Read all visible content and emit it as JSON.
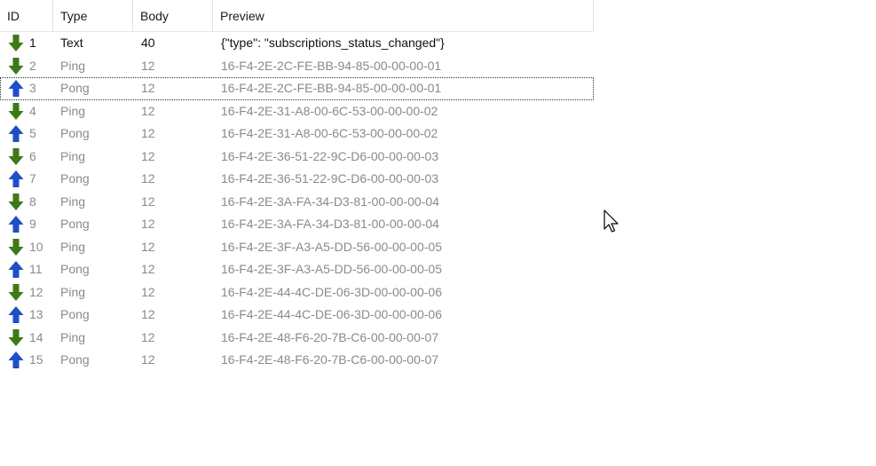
{
  "columns": {
    "id": "ID",
    "type": "Type",
    "body": "Body",
    "preview": "Preview"
  },
  "colors": {
    "incoming_arrow": "#3d7a16",
    "outgoing_arrow": "#1f4fc7"
  },
  "icons": {
    "in": "arrow-down-icon",
    "out": "arrow-up-icon"
  },
  "selected_row": 3,
  "rows": [
    {
      "id": "1",
      "dir": "in",
      "type": "Text",
      "body": "40",
      "preview": "{\"type\": \"subscriptions_status_changed\"}"
    },
    {
      "id": "2",
      "dir": "in",
      "type": "Ping",
      "body": "12",
      "preview": "16-F4-2E-2C-FE-BB-94-85-00-00-00-01"
    },
    {
      "id": "3",
      "dir": "out",
      "type": "Pong",
      "body": "12",
      "preview": "16-F4-2E-2C-FE-BB-94-85-00-00-00-01"
    },
    {
      "id": "4",
      "dir": "in",
      "type": "Ping",
      "body": "12",
      "preview": "16-F4-2E-31-A8-00-6C-53-00-00-00-02"
    },
    {
      "id": "5",
      "dir": "out",
      "type": "Pong",
      "body": "12",
      "preview": "16-F4-2E-31-A8-00-6C-53-00-00-00-02"
    },
    {
      "id": "6",
      "dir": "in",
      "type": "Ping",
      "body": "12",
      "preview": "16-F4-2E-36-51-22-9C-D6-00-00-00-03"
    },
    {
      "id": "7",
      "dir": "out",
      "type": "Pong",
      "body": "12",
      "preview": "16-F4-2E-36-51-22-9C-D6-00-00-00-03"
    },
    {
      "id": "8",
      "dir": "in",
      "type": "Ping",
      "body": "12",
      "preview": "16-F4-2E-3A-FA-34-D3-81-00-00-00-04"
    },
    {
      "id": "9",
      "dir": "out",
      "type": "Pong",
      "body": "12",
      "preview": "16-F4-2E-3A-FA-34-D3-81-00-00-00-04"
    },
    {
      "id": "10",
      "dir": "in",
      "type": "Ping",
      "body": "12",
      "preview": "16-F4-2E-3F-A3-A5-DD-56-00-00-00-05"
    },
    {
      "id": "11",
      "dir": "out",
      "type": "Pong",
      "body": "12",
      "preview": "16-F4-2E-3F-A3-A5-DD-56-00-00-00-05"
    },
    {
      "id": "12",
      "dir": "in",
      "type": "Ping",
      "body": "12",
      "preview": "16-F4-2E-44-4C-DE-06-3D-00-00-00-06"
    },
    {
      "id": "13",
      "dir": "out",
      "type": "Pong",
      "body": "12",
      "preview": "16-F4-2E-44-4C-DE-06-3D-00-00-00-06"
    },
    {
      "id": "14",
      "dir": "in",
      "type": "Ping",
      "body": "12",
      "preview": "16-F4-2E-48-F6-20-7B-C6-00-00-00-07"
    },
    {
      "id": "15",
      "dir": "out",
      "type": "Pong",
      "body": "12",
      "preview": "16-F4-2E-48-F6-20-7B-C6-00-00-00-07"
    }
  ]
}
